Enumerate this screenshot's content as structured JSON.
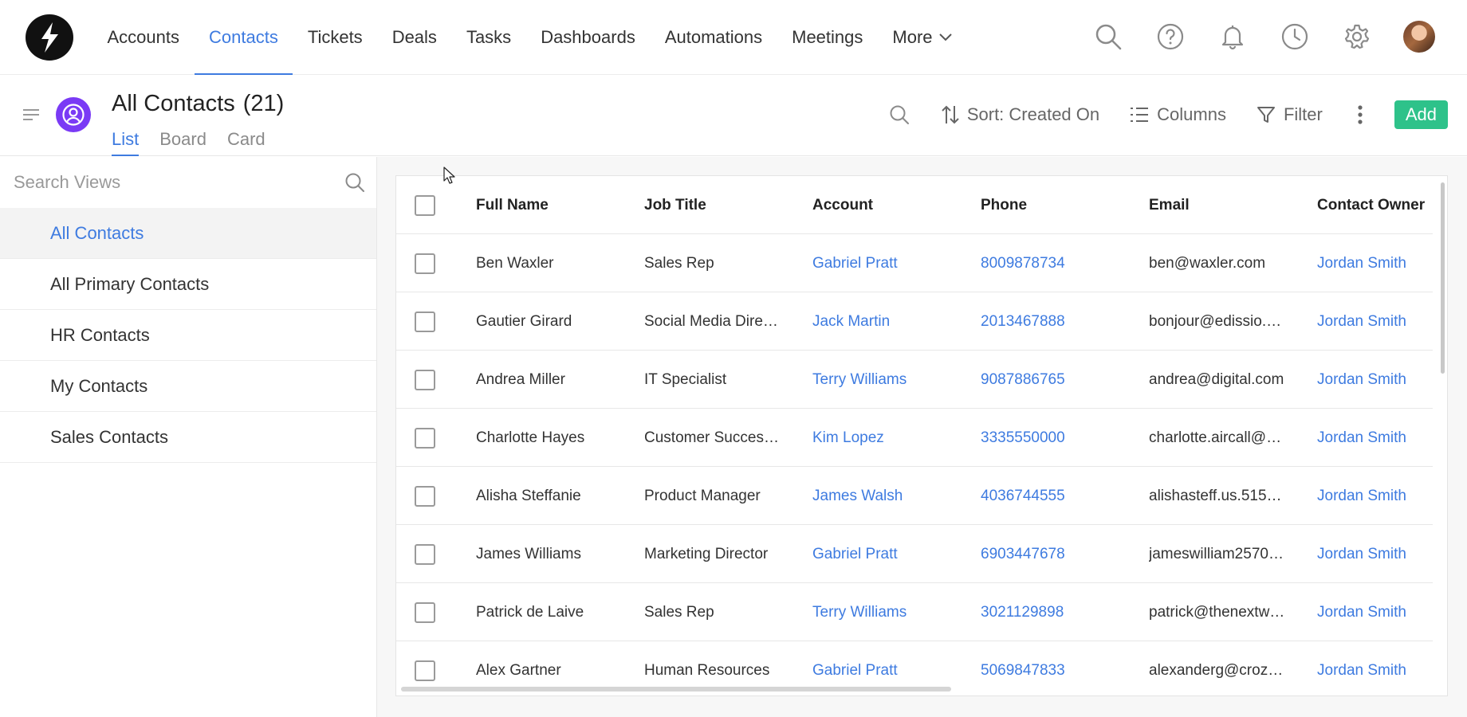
{
  "nav": {
    "items": [
      {
        "label": "Accounts",
        "active": false
      },
      {
        "label": "Contacts",
        "active": true
      },
      {
        "label": "Tickets",
        "active": false
      },
      {
        "label": "Deals",
        "active": false
      },
      {
        "label": "Tasks",
        "active": false
      },
      {
        "label": "Dashboards",
        "active": false
      },
      {
        "label": "Automations",
        "active": false
      },
      {
        "label": "Meetings",
        "active": false
      }
    ],
    "more_label": "More",
    "icons": [
      "search-icon",
      "help-icon",
      "bell-icon",
      "clock-icon",
      "gear-icon"
    ]
  },
  "header": {
    "title": "All Contacts",
    "count": "(21)",
    "tabs": [
      {
        "label": "List",
        "active": true
      },
      {
        "label": "Board",
        "active": false
      },
      {
        "label": "Card",
        "active": false
      }
    ],
    "sort_label": "Sort: Created On",
    "columns_label": "Columns",
    "filter_label": "Filter",
    "add_label": "Add"
  },
  "sidebar": {
    "search_placeholder": "Search Views",
    "views": [
      {
        "label": "All Contacts",
        "selected": true
      },
      {
        "label": "All Primary Contacts",
        "selected": false
      },
      {
        "label": "HR Contacts",
        "selected": false
      },
      {
        "label": "My Contacts",
        "selected": false
      },
      {
        "label": "Sales Contacts",
        "selected": false
      }
    ]
  },
  "table": {
    "columns": [
      "Full Name",
      "Job Title",
      "Account",
      "Phone",
      "Email",
      "Contact Owner"
    ],
    "rows": [
      {
        "name": "Ben Waxler",
        "job": "Sales Rep",
        "account": "Gabriel Pratt",
        "phone": "8009878734",
        "email": "ben@waxler.com",
        "owner": "Jordan Smith"
      },
      {
        "name": "Gautier Girard",
        "job": "Social Media Dire…",
        "account": "Jack Martin",
        "phone": "2013467888",
        "email": "bonjour@edissio.…",
        "owner": "Jordan Smith"
      },
      {
        "name": "Andrea Miller",
        "job": "IT Specialist",
        "account": "Terry Williams",
        "phone": "9087886765",
        "email": "andrea@digital.com",
        "owner": "Jordan Smith"
      },
      {
        "name": "Charlotte Hayes",
        "job": "Customer Succes…",
        "account": "Kim Lopez",
        "phone": "3335550000",
        "email": "charlotte.aircall@…",
        "owner": "Jordan Smith"
      },
      {
        "name": "Alisha Steffanie",
        "job": "Product Manager",
        "account": "James Walsh",
        "phone": "4036744555",
        "email": "alishasteff.us.515…",
        "owner": "Jordan Smith"
      },
      {
        "name": "James Williams",
        "job": "Marketing Director",
        "account": "Gabriel Pratt",
        "phone": "6903447678",
        "email": "jameswilliam2570…",
        "owner": "Jordan Smith"
      },
      {
        "name": "Patrick de Laive",
        "job": "Sales Rep",
        "account": "Terry Williams",
        "phone": "3021129898",
        "email": "patrick@thenextw…",
        "owner": "Jordan Smith"
      },
      {
        "name": "Alex Gartner",
        "job": "Human Resources",
        "account": "Gabriel Pratt",
        "phone": "5069847833",
        "email": "alexanderg@croz…",
        "owner": "Jordan Smith"
      }
    ]
  },
  "colors": {
    "accent": "#3e7be0",
    "add_button": "#2ec28a",
    "module_icon": "#7a3af5"
  }
}
